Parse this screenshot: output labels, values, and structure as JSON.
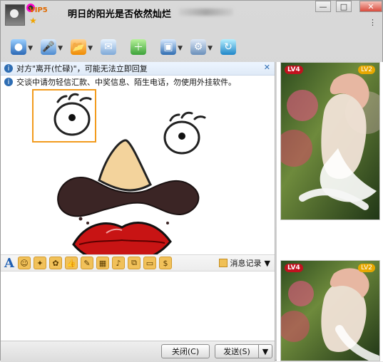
{
  "titlebar": {
    "vip_label": "VIP5",
    "title": "明日的阳光是否依然灿烂"
  },
  "notice": {
    "text": "对方\"离开(忙碌)\"，可能无法立即回复",
    "close_glyph": "✕"
  },
  "safety_tip": {
    "text": "交谈中请勿轻信汇款、中奖信息、陌生电话，勿使用外挂软件。"
  },
  "format_toolbar": {
    "history_label": "消息记录"
  },
  "bottom_buttons": {
    "close_label": "关闭(C)",
    "send_label": "发送(S)"
  },
  "right_panel": {
    "level_top": "LV4",
    "level_top_right": "LV2",
    "level_bottom": "LV4",
    "level_bottom_right": "LV2"
  },
  "icons": {
    "window_minimize": "minimize-icon",
    "window_maximize": "maximize-icon",
    "window_close": "close-icon",
    "video": "video-call-icon",
    "mic": "voice-call-icon",
    "folder": "file-transfer-icon",
    "mail": "mail-icon",
    "add": "add-app-icon",
    "remote": "remote-assist-icon",
    "settings": "settings-icon",
    "apps": "apps-icon"
  },
  "colors": {
    "accent_blue": "#1f5fb3",
    "selection_orange": "#f29b1d",
    "vip_orange": "#e06a00",
    "level_red": "#c1121f"
  }
}
